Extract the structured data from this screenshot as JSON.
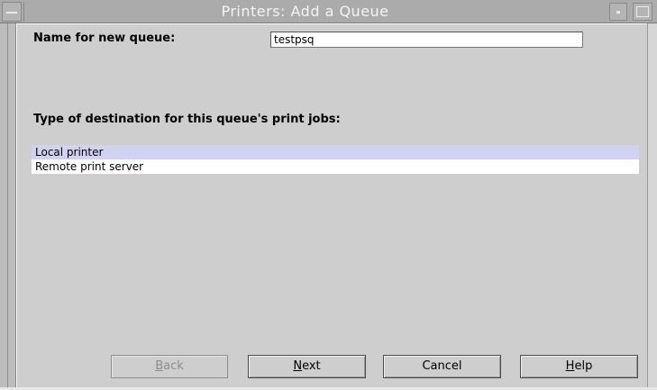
{
  "window": {
    "title": "Printers: Add a Queue"
  },
  "form": {
    "name_label": "Name for new queue:",
    "name_value": "testpsq",
    "type_label": "Type of destination for this queue's print jobs:",
    "destinations": [
      {
        "label": "Local printer",
        "selected": true
      },
      {
        "label": "Remote print server",
        "selected": false
      }
    ]
  },
  "buttons": {
    "back": {
      "mnemonic": "B",
      "rest": "ack",
      "enabled": false
    },
    "next": {
      "mnemonic": "N",
      "rest": "ext",
      "enabled": true
    },
    "cancel": {
      "label": "Cancel",
      "enabled": true
    },
    "help": {
      "mnemonic": "H",
      "rest": "elp",
      "enabled": true
    }
  },
  "colors": {
    "titlebar": "#ababab",
    "client_bg": "#cecece",
    "selection": "#d1d1f2"
  }
}
